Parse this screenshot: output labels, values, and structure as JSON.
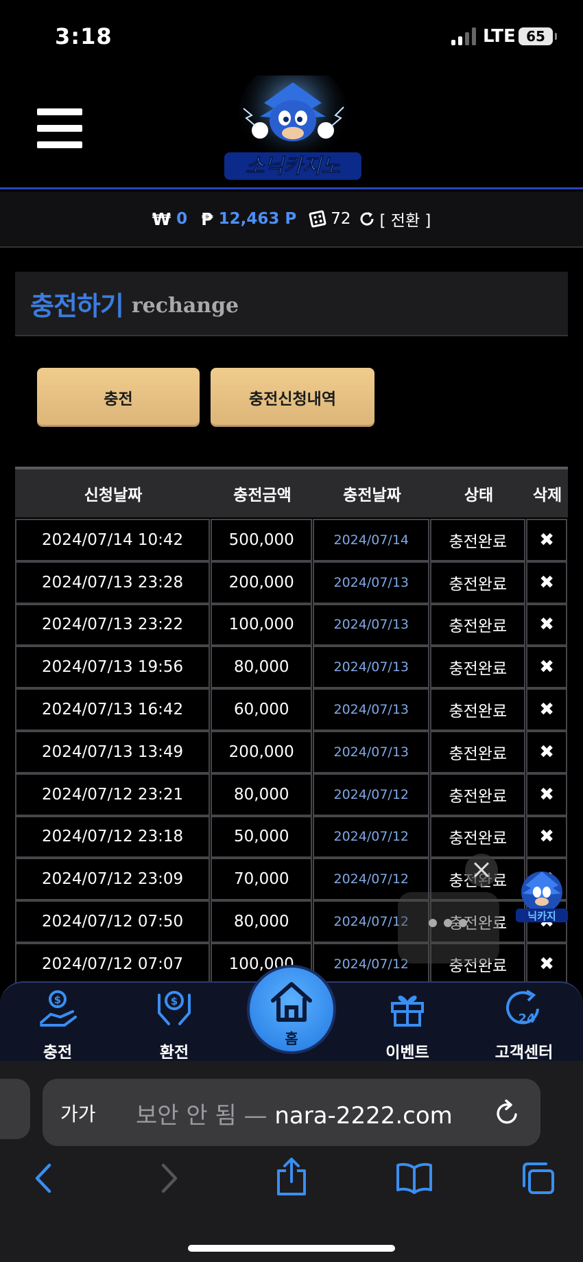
{
  "status": {
    "time": "3:18",
    "network": "LTE",
    "battery": "65"
  },
  "header": {
    "logo_icon": "sonic-casino-logo",
    "menu_icon": "hamburger-icon"
  },
  "balance": {
    "won_symbol": "₩",
    "won_value": "0",
    "point_symbol": "₱",
    "point_value": "12,463 P",
    "chip_value": "72",
    "switch_label": "[ 전환 ]"
  },
  "section": {
    "title_ko": "충전하기",
    "title_en": "rechange"
  },
  "buttons": {
    "charge": "충전",
    "history": "충전신청내역",
    "color": "#e5c284"
  },
  "table": {
    "headers": [
      "신청날짜",
      "충전금액",
      "충전날짜",
      "상태",
      "삭제"
    ],
    "rows": [
      {
        "request": "2024/07/14 10:42",
        "amount": "500,000",
        "date": "2024/07/14",
        "status": "충전완료",
        "del": "✖"
      },
      {
        "request": "2024/07/13 23:28",
        "amount": "200,000",
        "date": "2024/07/13",
        "status": "충전완료",
        "del": "✖"
      },
      {
        "request": "2024/07/13 23:22",
        "amount": "100,000",
        "date": "2024/07/13",
        "status": "충전완료",
        "del": "✖"
      },
      {
        "request": "2024/07/13 19:56",
        "amount": "80,000",
        "date": "2024/07/13",
        "status": "충전완료",
        "del": "✖"
      },
      {
        "request": "2024/07/13 16:42",
        "amount": "60,000",
        "date": "2024/07/13",
        "status": "충전완료",
        "del": "✖"
      },
      {
        "request": "2024/07/13 13:49",
        "amount": "200,000",
        "date": "2024/07/13",
        "status": "충전완료",
        "del": "✖"
      },
      {
        "request": "2024/07/12 23:21",
        "amount": "80,000",
        "date": "2024/07/12",
        "status": "충전완료",
        "del": "✖"
      },
      {
        "request": "2024/07/12 23:18",
        "amount": "50,000",
        "date": "2024/07/12",
        "status": "충전완료",
        "del": "✖"
      },
      {
        "request": "2024/07/12 23:09",
        "amount": "70,000",
        "date": "2024/07/12",
        "status": "충전완료",
        "del": "✖"
      },
      {
        "request": "2024/07/12 07:50",
        "amount": "80,000",
        "date": "2024/07/12",
        "status": "충전완료",
        "del": "✖"
      },
      {
        "request": "2024/07/12 07:07",
        "amount": "100,000",
        "date": "2024/07/12",
        "status": "충전완료",
        "del": "✖"
      }
    ]
  },
  "bottom_nav": {
    "charge": "충전",
    "exchange": "환전",
    "home": "홈",
    "event": "이벤트",
    "support": "고객센터"
  },
  "browser": {
    "aa": "가가",
    "insecure": "보안 안 됨 —",
    "domain": "nara-2222.com"
  },
  "colors": {
    "accent": "#3b7de0",
    "nav_bg": "#0e1426",
    "home": "#2a8cf0"
  }
}
